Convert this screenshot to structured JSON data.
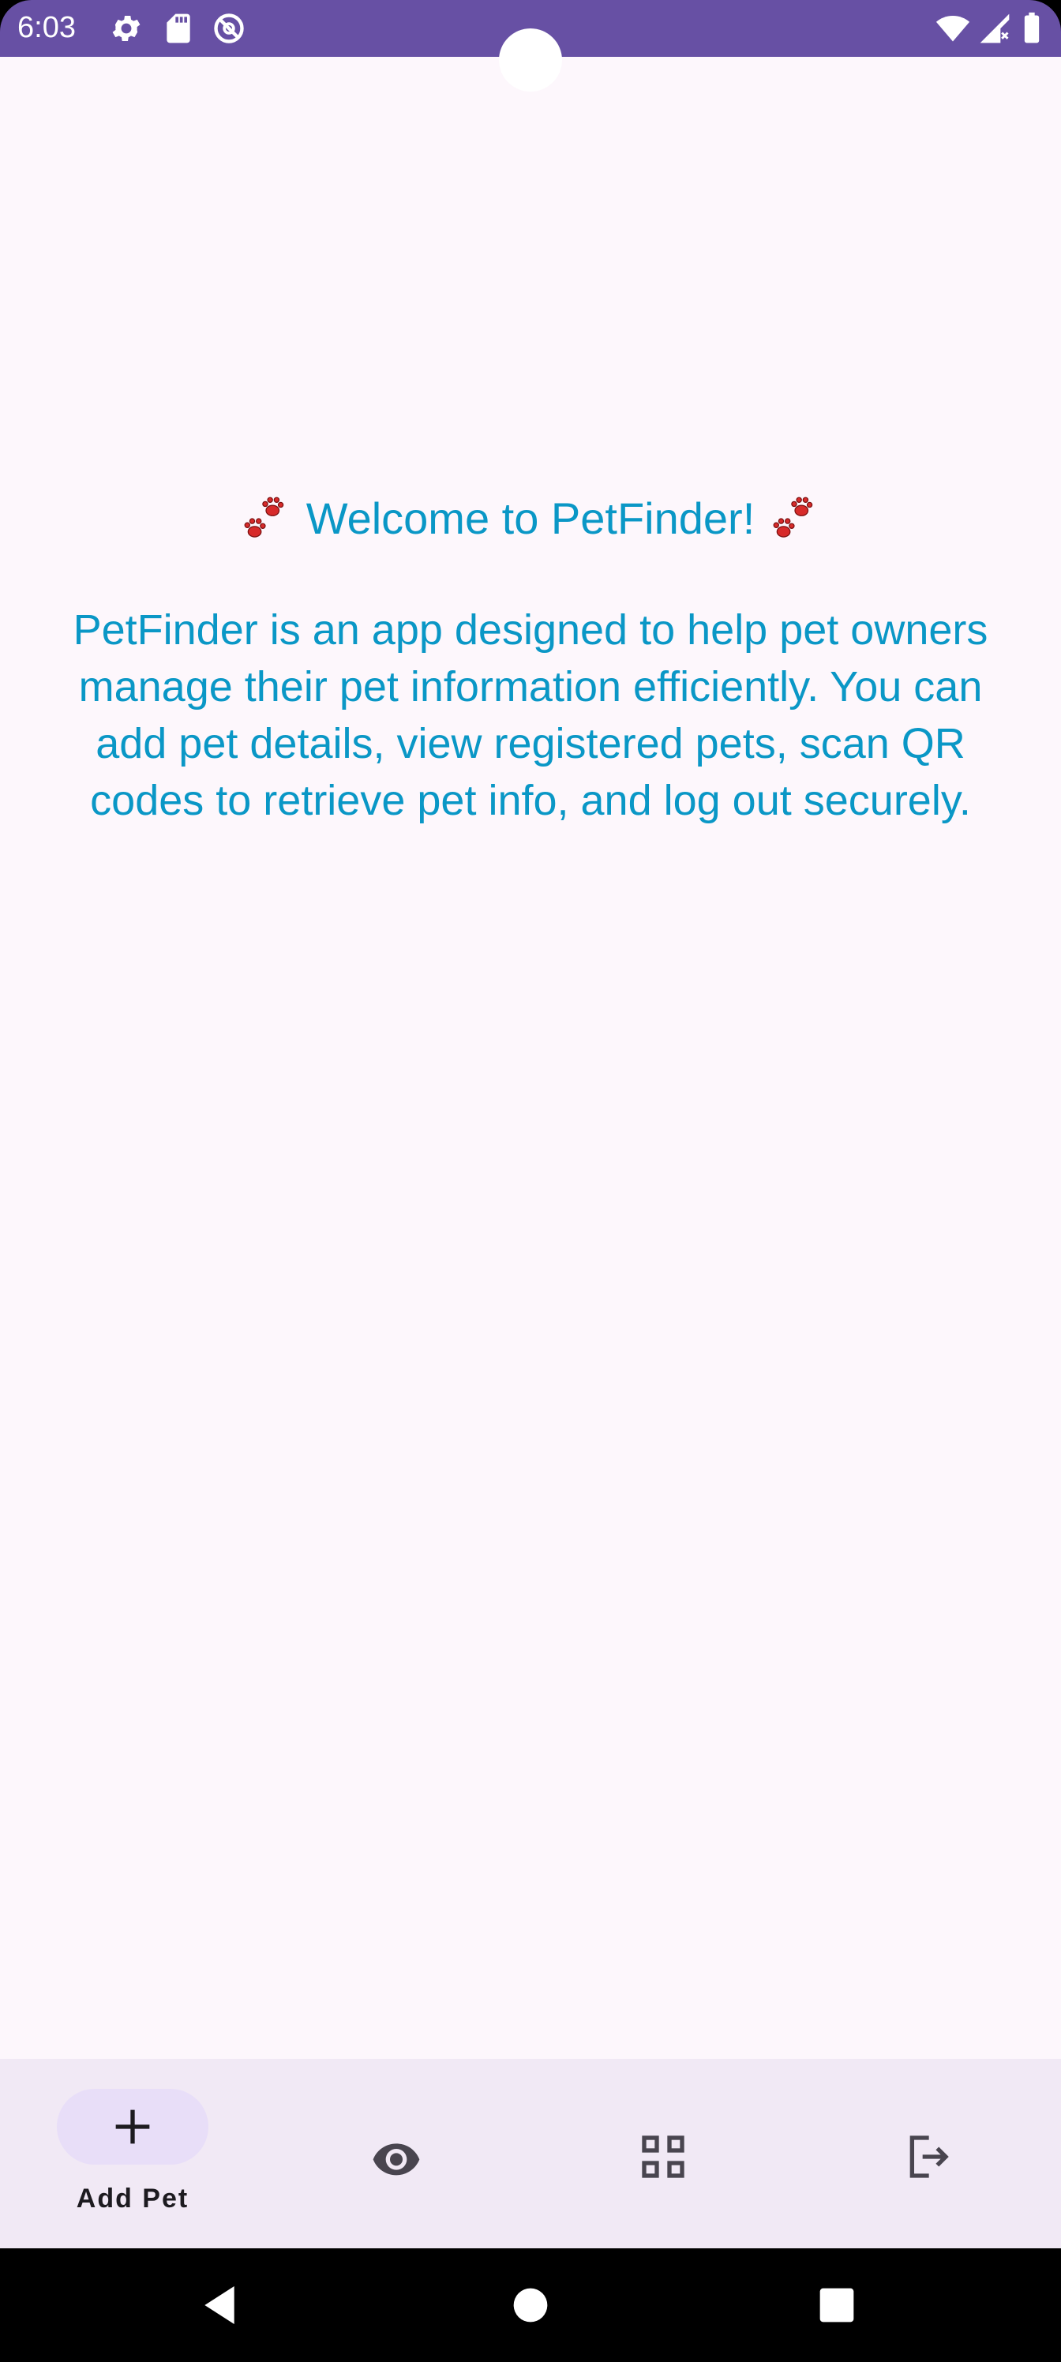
{
  "status_bar": {
    "time": "6:03",
    "background": "#6750A4",
    "left_icons": [
      "gear-icon",
      "sd-card-icon",
      "do-not-disturb-icon"
    ],
    "right_icons": [
      "wifi-icon",
      "cellular-signal-icon",
      "battery-icon"
    ]
  },
  "welcome": {
    "title": "Welcome to PetFinder!",
    "description": "PetFinder is an app designed to help pet owners manage their pet information efficiently. You can add pet details, view registered pets, scan QR codes to retrieve pet info, and log out securely.",
    "text_color": "#0A97C6",
    "decoration_icon": "paw-prints-icon"
  },
  "bottom_nav": {
    "items": [
      {
        "icon": "plus-icon",
        "label": "Add Pet",
        "selected": true
      },
      {
        "icon": "eye-icon",
        "label": "",
        "selected": false
      },
      {
        "icon": "qr-grid-icon",
        "label": "",
        "selected": false
      },
      {
        "icon": "logout-icon",
        "label": "",
        "selected": false
      }
    ],
    "background": "#F1E9F5",
    "selected_pill_color": "#E8DEF8"
  },
  "system_nav": {
    "buttons": [
      "back-icon",
      "home-icon",
      "recents-icon"
    ]
  }
}
